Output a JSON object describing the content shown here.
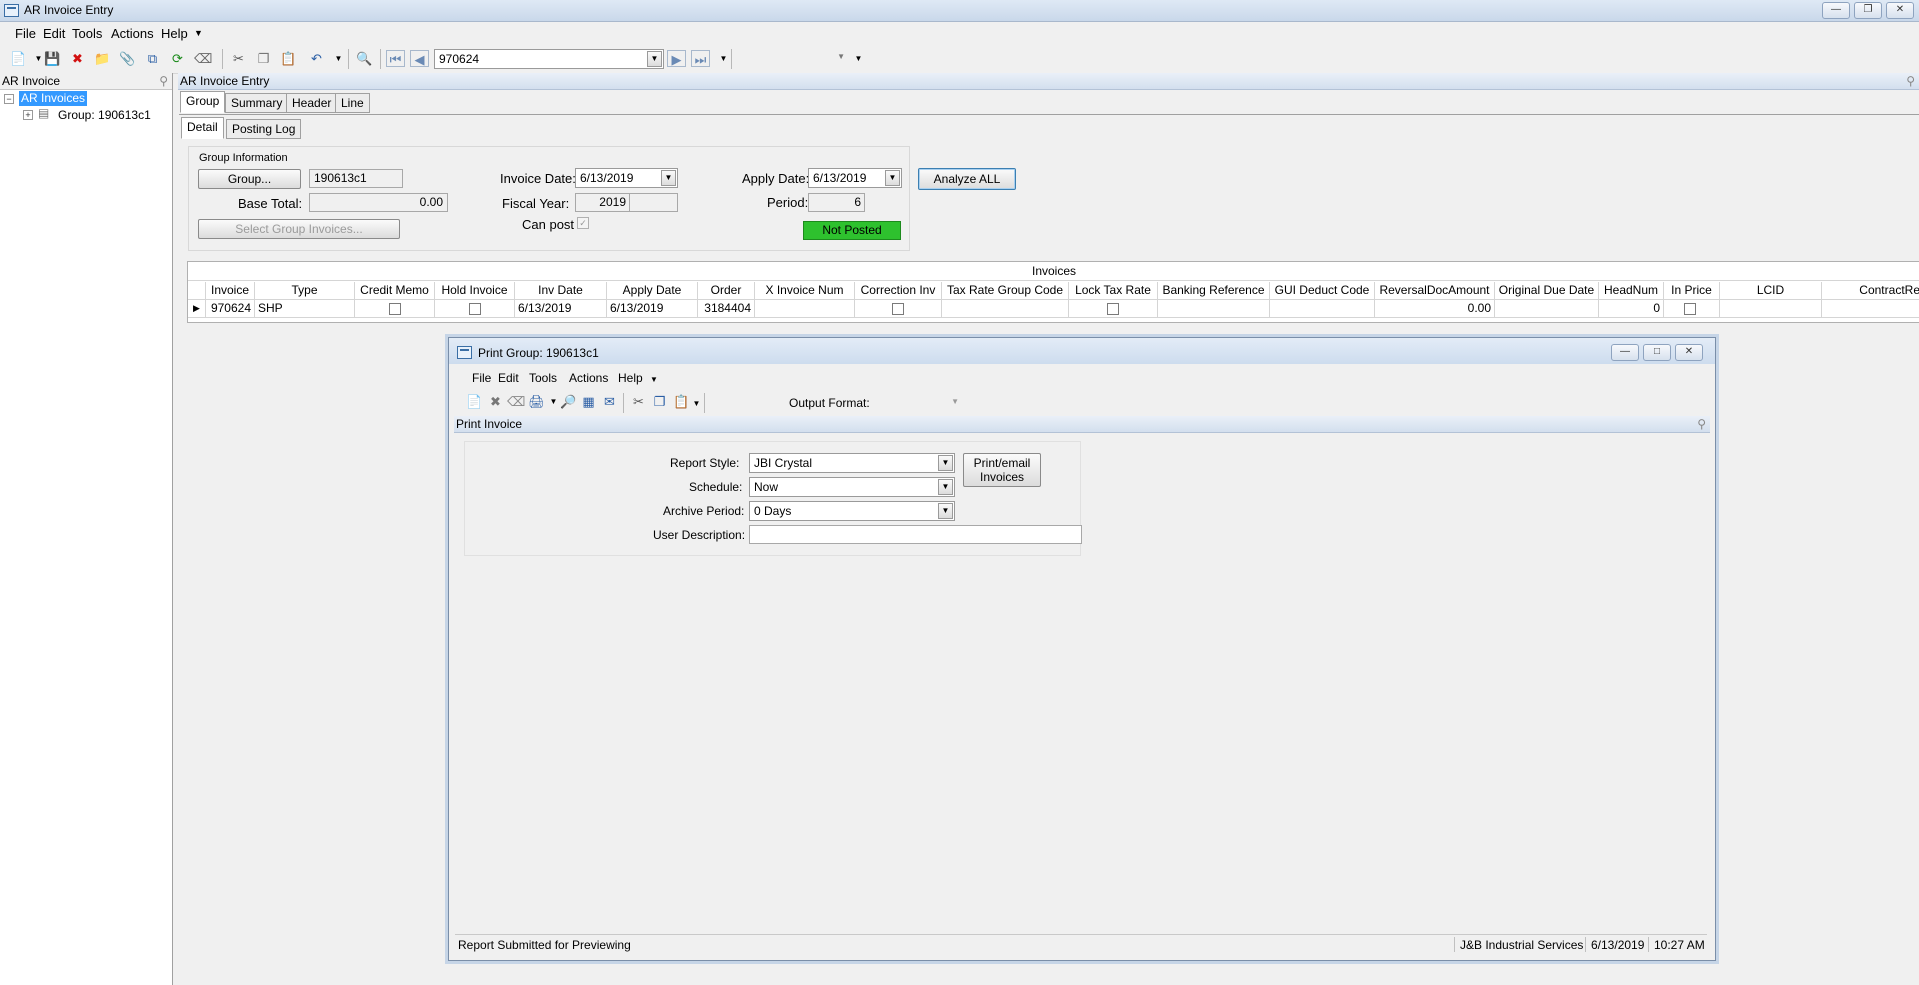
{
  "window": {
    "title": "AR Invoice Entry"
  },
  "menu": [
    "File",
    "Edit",
    "Tools",
    "Actions",
    "Help"
  ],
  "toolbar": {
    "invoice_value": "970624"
  },
  "left_panel": {
    "title": "AR Invoice",
    "tree_root": "AR Invoices",
    "tree_child": "Group: 190613c1"
  },
  "main_panel": {
    "title": "AR Invoice Entry"
  },
  "tabs": [
    "Group",
    "Summary",
    "Header",
    "Line"
  ],
  "subtabs": [
    "Detail",
    "Posting Log"
  ],
  "group_info": {
    "legend": "Group Information",
    "group_button": "Group...",
    "group_value": "190613c1",
    "base_total_label": "Base Total:",
    "base_total_value": "0.00",
    "select_group_invoices": "Select Group Invoices...",
    "invoice_date_label": "Invoice Date:",
    "invoice_date_value": "6/13/2019",
    "fiscal_year_label": "Fiscal Year:",
    "fiscal_year_value": "2019",
    "can_post_label": "Can post",
    "apply_date_label": "Apply Date:",
    "apply_date_value": "6/13/2019",
    "period_label": "Period:",
    "period_value": "6",
    "status": "Not Posted",
    "analyze_all": "Analyze ALL"
  },
  "invoices_grid": {
    "title": "Invoices",
    "columns": [
      "Invoice",
      "Type",
      "Credit Memo",
      "Hold Invoice",
      "Inv Date",
      "Apply Date",
      "Order",
      "X Invoice Num",
      "Correction Inv",
      "Tax Rate Group Code",
      "Lock Tax Rate",
      "Banking Reference",
      "GUI Deduct Code",
      "ReversalDocAmount",
      "Original Due Date",
      "HeadNum",
      "In Price",
      "LCID",
      "ContractRe"
    ],
    "row": {
      "invoice": "970624",
      "type": "SHP",
      "inv_date": "6/13/2019",
      "apply_date": "6/13/2019",
      "order": "3184404",
      "reversal_doc_amount": "0.00",
      "head_num": "0"
    }
  },
  "dialog": {
    "title": "Print Group: 190613c1",
    "menu": [
      "File",
      "Edit",
      "Tools",
      "Actions",
      "Help"
    ],
    "output_format_label": "Output Format:",
    "panel_title": "Print Invoice",
    "report_style_label": "Report Style:",
    "report_style_value": "JBI Crystal",
    "schedule_label": "Schedule:",
    "schedule_value": "Now",
    "archive_period_label": "Archive Period:",
    "archive_period_value": "0 Days",
    "user_description_label": "User Description:",
    "user_description_value": "",
    "print_button_line1": "Print/email",
    "print_button_line2": "Invoices",
    "status_text": "Report Submitted for Previewing",
    "company": "J&B Industrial Services",
    "date": "6/13/2019",
    "time": "10:27 AM"
  }
}
